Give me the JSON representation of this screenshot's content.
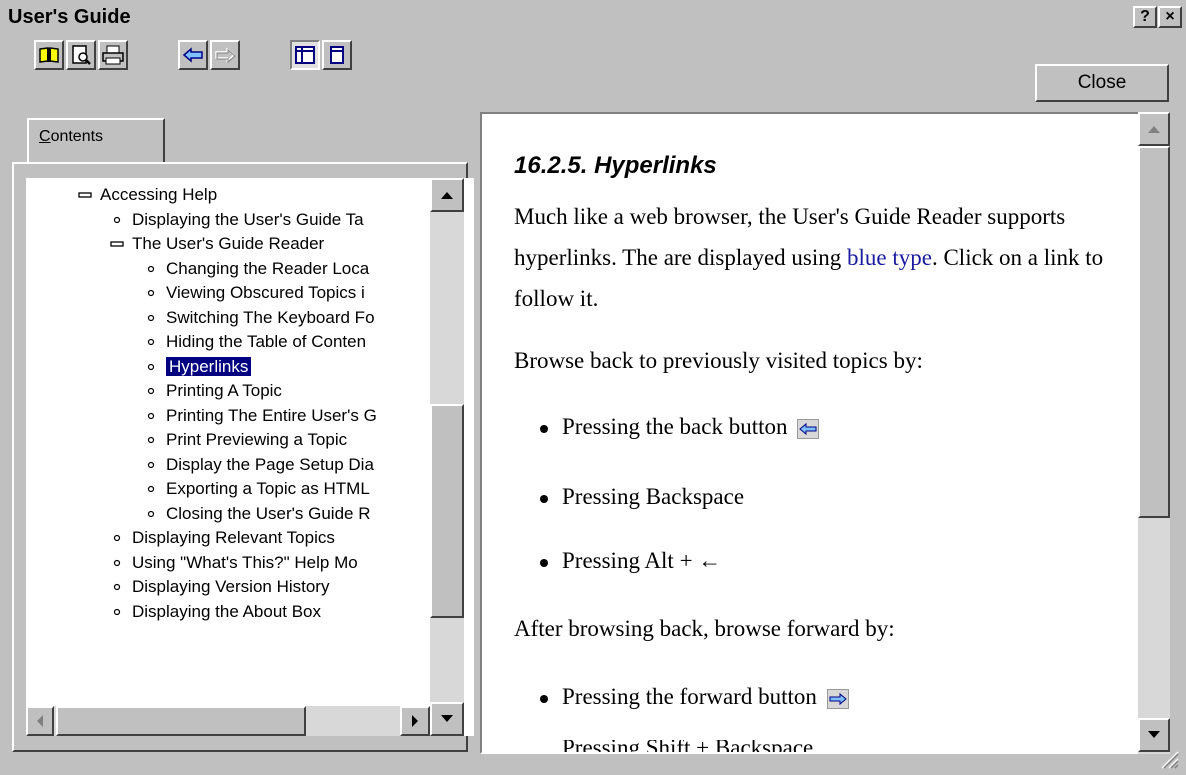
{
  "window": {
    "title": "User's Guide",
    "help_btn": "?",
    "close_btn": "×"
  },
  "toolbar": {
    "icons": [
      "book-icon",
      "print-preview-icon",
      "print-icon",
      "back-arrow-icon",
      "forward-arrow-icon",
      "two-pane-icon",
      "one-pane-icon"
    ],
    "close_label": "Close"
  },
  "tabs": {
    "contents_label": "Contents",
    "contents_mnemonic": "C",
    "contents_rest": "ontents"
  },
  "tree": {
    "items": [
      {
        "label": "Accessing Help",
        "marker": "minus"
      },
      {
        "label": "Displaying the User's Guide Ta",
        "marker": "dot"
      },
      {
        "label": "The User's Guide Reader",
        "marker": "minus"
      },
      {
        "label": "Changing the Reader Loca",
        "marker": "dot"
      },
      {
        "label": "Viewing Obscured Topics i",
        "marker": "dot"
      },
      {
        "label": "Switching The Keyboard Fo",
        "marker": "dot"
      },
      {
        "label": "Hiding the Table of Conten",
        "marker": "dot"
      },
      {
        "label": "Hyperlinks",
        "marker": "dot",
        "selected": true
      },
      {
        "label": "Printing A Topic",
        "marker": "dot"
      },
      {
        "label": "Printing The Entire User's G",
        "marker": "dot"
      },
      {
        "label": "Print Previewing a Topic",
        "marker": "dot"
      },
      {
        "label": "Display the Page Setup Dia",
        "marker": "dot"
      },
      {
        "label": "Exporting a Topic as HTML",
        "marker": "dot"
      },
      {
        "label": "Closing the User's Guide R",
        "marker": "dot"
      },
      {
        "label": "Displaying Relevant Topics",
        "marker": "dot"
      },
      {
        "label": "Using \"What's This?\" Help Mo",
        "marker": "dot"
      },
      {
        "label": "Displaying Version History",
        "marker": "dot"
      },
      {
        "label": "Displaying the About Box",
        "marker": "dot"
      }
    ]
  },
  "content": {
    "heading": "16.2.5. Hyperlinks",
    "para1_pre": "Much like a web browser, the User's Guide Reader supports hyperlinks. The are displayed using ",
    "para1_link": "blue type",
    "para1_post": ". Click on a link to follow it.",
    "para2": "Browse back to previously visited topics by:",
    "bullets_back": [
      "Pressing the back button",
      "Pressing Backspace",
      "Pressing Alt + ←"
    ],
    "para3": "After browsing back, browse forward by:",
    "bullets_forward": [
      "Pressing the forward button",
      "Pressing Shift + Backspace"
    ]
  },
  "colors": {
    "selection": "#000080",
    "link": "#1a1aa0",
    "chrome": "#c0c0c0"
  }
}
